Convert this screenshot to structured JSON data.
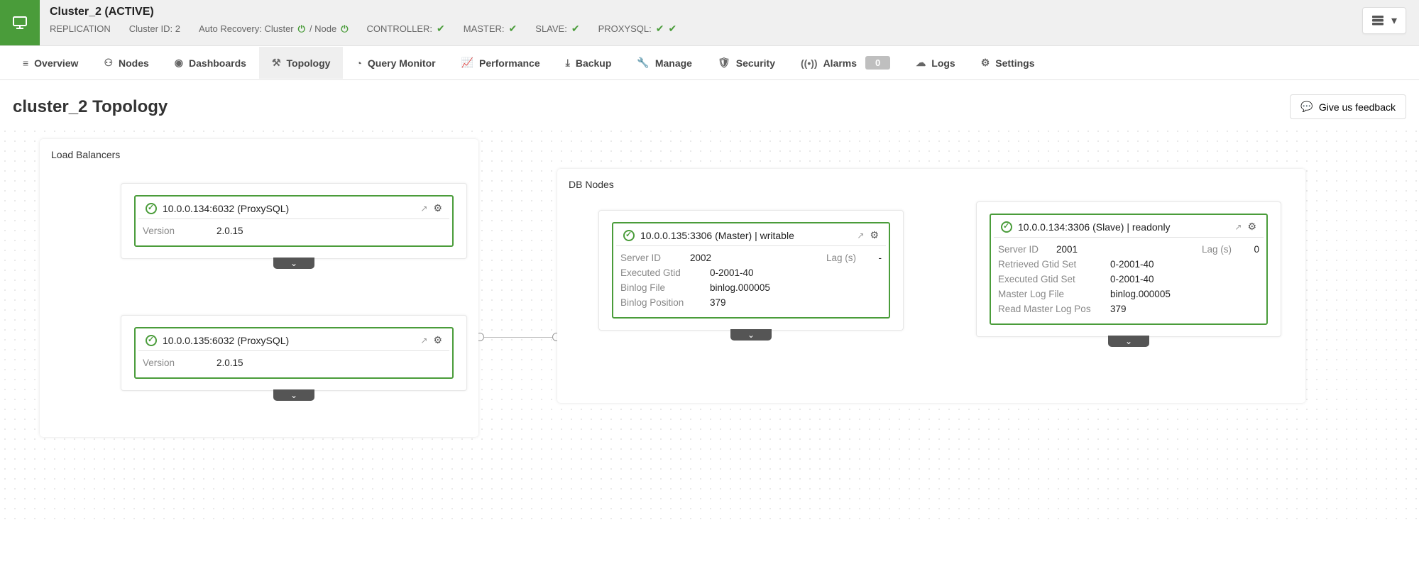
{
  "header": {
    "cluster_title": "Cluster_2 (ACTIVE)",
    "replication_label": "REPLICATION",
    "cluster_id_label": "Cluster ID: 2",
    "auto_recovery_label": "Auto Recovery: Cluster",
    "auto_recovery_sep": " / Node",
    "status_items": [
      {
        "label": "CONTROLLER:"
      },
      {
        "label": "MASTER:"
      },
      {
        "label": "SLAVE:"
      },
      {
        "label": "PROXYSQL:"
      }
    ]
  },
  "nav": {
    "tabs": [
      "Overview",
      "Nodes",
      "Dashboards",
      "Topology",
      "Query Monitor",
      "Performance",
      "Backup",
      "Manage",
      "Security",
      "Alarms",
      "Logs",
      "Settings"
    ],
    "alarms_count": "0",
    "active_index": 3
  },
  "page": {
    "title": "cluster_2 Topology",
    "feedback_label": "Give us feedback"
  },
  "panels": {
    "lb_title": "Load Balancers",
    "db_title": "DB Nodes"
  },
  "lb_nodes": [
    {
      "title": "10.0.0.134:6032 (ProxySQL)",
      "version_label": "Version",
      "version_value": "2.0.15"
    },
    {
      "title": "10.0.0.135:6032 (ProxySQL)",
      "version_label": "Version",
      "version_value": "2.0.15"
    }
  ],
  "db_master": {
    "title": "10.0.0.135:3306 (Master) | writable",
    "rows": {
      "server_id_label": "Server ID",
      "server_id": "2002",
      "lag_label": "Lag (s)",
      "lag": "-",
      "exec_gtid_label": "Executed Gtid",
      "exec_gtid": "0-2001-40",
      "binlog_file_label": "Binlog File",
      "binlog_file": "binlog.000005",
      "binlog_pos_label": "Binlog Position",
      "binlog_pos": "379"
    }
  },
  "db_slave": {
    "title": "10.0.0.134:3306 (Slave) | readonly",
    "rows": {
      "server_id_label": "Server ID",
      "server_id": "2001",
      "lag_label": "Lag (s)",
      "lag": "0",
      "retr_gtid_label": "Retrieved Gtid Set",
      "retr_gtid": "0-2001-40",
      "exec_gtid_label": "Executed Gtid Set",
      "exec_gtid": "0-2001-40",
      "master_log_file_label": "Master Log File",
      "master_log_file": "binlog.000005",
      "read_master_pos_label": "Read Master Log Pos",
      "read_master_pos": "379"
    }
  }
}
